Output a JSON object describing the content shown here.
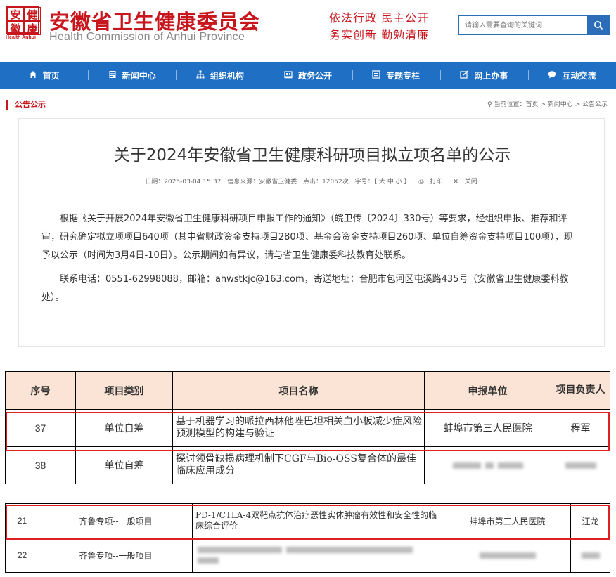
{
  "header": {
    "logo_chars": [
      "安",
      "健",
      "徽",
      "康"
    ],
    "logo_en": "Health Anhui",
    "title": "安徽省卫生健康委员会",
    "subtitle": "Health Commission of Anhui Province",
    "slogan_line1": "依法行政 民主公开",
    "slogan_line2": "务实创新 勤勉清廉",
    "search_placeholder": "请输入需要查询的关键词"
  },
  "nav": {
    "items": [
      {
        "icon": "home-icon",
        "label": "首页"
      },
      {
        "icon": "news-icon",
        "label": "新闻中心"
      },
      {
        "icon": "org-icon",
        "label": "组织机构"
      },
      {
        "icon": "gov-icon",
        "label": "政务公开"
      },
      {
        "icon": "topic-icon",
        "label": "专题专栏"
      },
      {
        "icon": "online-icon",
        "label": "网上办事"
      },
      {
        "icon": "chat-icon",
        "label": "互动交流"
      }
    ]
  },
  "notice": {
    "label": "公告公示",
    "breadcrumb": "当前位置：首页 > 新闻中心 > 公告公示"
  },
  "article": {
    "title": "关于2024年安徽省卫生健康科研项目拟立项名单的公示",
    "date": "日期：2025-03-04 15:37",
    "source": "信息来源：安徽省卫健委",
    "clicks": "点击：12052次",
    "font_size": "字号：【 大 中 小 】",
    "print": "打印",
    "close": "关闭",
    "para1": "根据《关于开展2024年安徽省卫生健康科研项目申报工作的通知》（皖卫传〔2024〕330号）等要求，经组织申报、推荐和评审，研究确定拟立项项目640项（其中省财政资金支持项目280项、基金会资金支持项目260项、单位自筹资金支持项目100项），现予以公示（时间为3月4日-10日）。公示期间如有异议，请与省卫生健康委科技教育处联系。",
    "para2": "联系电话：0551-62998088，邮箱：ahwstkjc@163.com，寄送地址：合肥市包河区屯溪路435号（安徽省卫生健康委科教处）。"
  },
  "table1": {
    "headers": [
      "序号",
      "项目类别",
      "项目名称",
      "申报单位",
      "项目负责人"
    ],
    "rows": [
      {
        "no": "37",
        "category": "单位自筹",
        "name": "基于机器学习的哌拉西林他唑巴坦相关血小板减少症风险预测模型的构建与验证",
        "unit": "蚌埠市第三人民医院",
        "leader": "程军"
      },
      {
        "no": "38",
        "category": "单位自筹",
        "name": "探讨领骨缺损病理机制下CGF与Bio-OSS复合体的最佳临床应用成分",
        "unit": "",
        "leader": ""
      }
    ]
  },
  "table2": {
    "rows": [
      {
        "no": "21",
        "category": "齐鲁专项--一般项目",
        "name": "PD-1/CTLA-4双靶点抗体治疗恶性实体肿瘤有效性和安全性的临床综合评价",
        "unit": "蚌埠市第三人民医院",
        "leader": "汪龙"
      },
      {
        "no": "22",
        "category": "齐鲁专项--一般项目",
        "name": "",
        "unit": "",
        "leader": ""
      }
    ]
  },
  "colors": {
    "brand_red": "#c8161d",
    "nav_blue": "#1f6fc5",
    "header_fill": "#fbe4d5",
    "highlight": "#e02020"
  }
}
